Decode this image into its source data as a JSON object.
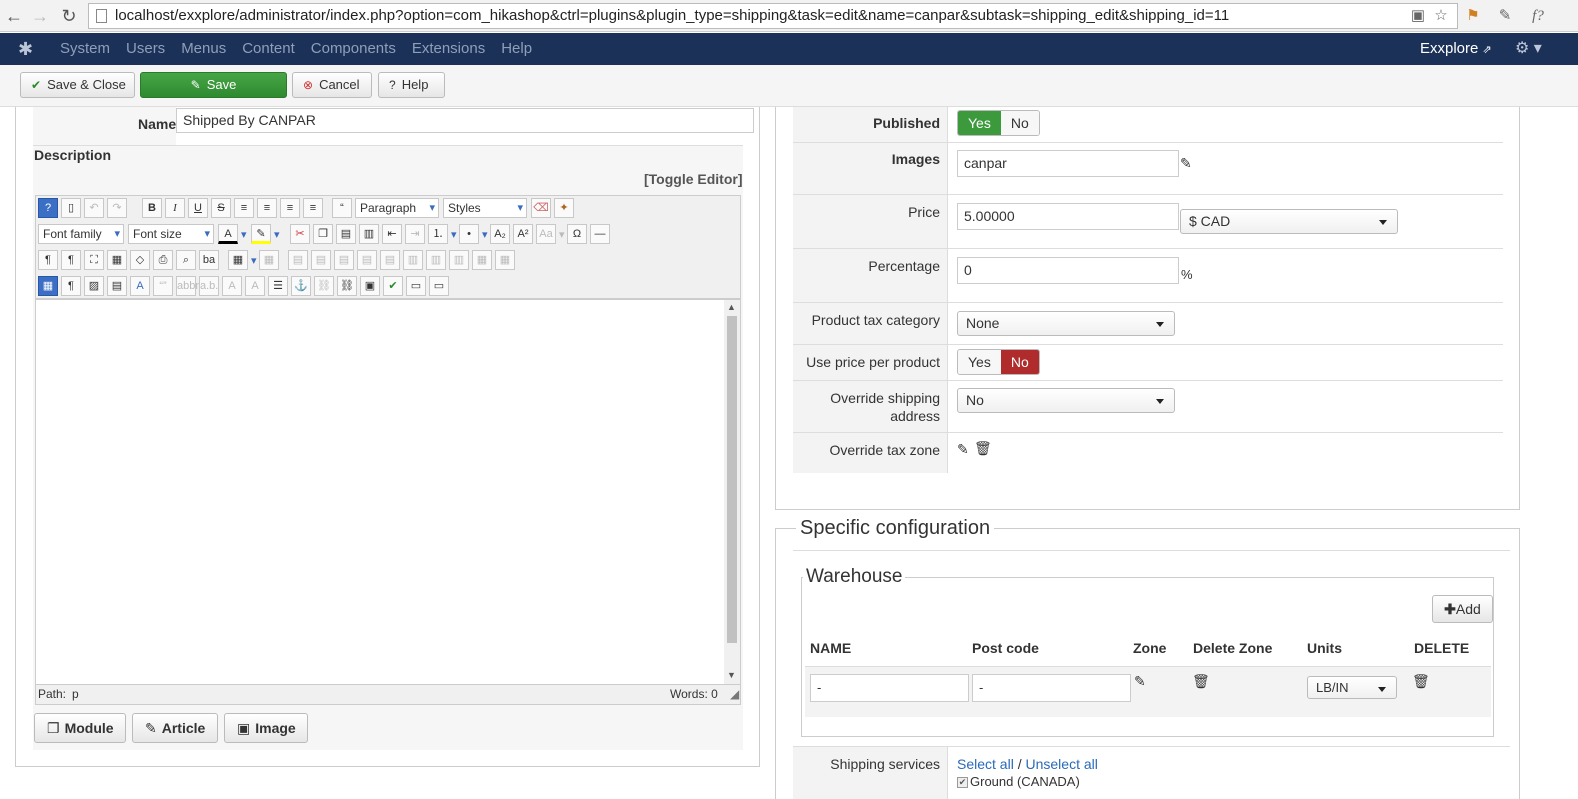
{
  "browser": {
    "url": "localhost/exxplore/administrator/index.php?option=com_hikashop&ctrl=plugins&plugin_type=shipping&task=edit&name=canpar&subtask=shipping_edit&shipping_id=11"
  },
  "navbar": {
    "menu": [
      "System",
      "Users",
      "Menus",
      "Content",
      "Components",
      "Extensions",
      "Help"
    ],
    "site_name": "Exxplore"
  },
  "toolbar": {
    "save_close": "Save & Close",
    "save": "Save",
    "cancel": "Cancel",
    "help": "Help"
  },
  "left": {
    "name_label": "Name",
    "name_value": "Shipped By CANPAR",
    "description_label": "Description",
    "toggle_editor": "[Toggle Editor]",
    "format_select": "Paragraph",
    "styles_select": "Styles",
    "font_family": "Font family",
    "font_size": "Font size",
    "path_label": "Path:",
    "path_value": "p",
    "words": "Words: 0",
    "buttons": {
      "module": "Module",
      "article": "Article",
      "image": "Image"
    }
  },
  "right": {
    "published_label": "Published",
    "published_yes": "Yes",
    "published_no": "No",
    "images_label": "Images",
    "images_value": "canpar",
    "price_label": "Price",
    "price_value": "5.00000",
    "currency": "$ CAD",
    "percentage_label": "Percentage",
    "percentage_value": "0",
    "percentage_unit": "%",
    "tax_category_label": "Product tax category",
    "tax_category_value": "None",
    "price_per_product_label": "Use price per product",
    "ppp_yes": "Yes",
    "ppp_no": "No",
    "override_address_label": "Override shipping address",
    "override_address_value": "No",
    "override_tax_label": "Override tax zone"
  },
  "specific": {
    "title": "Specific configuration",
    "warehouse_title": "Warehouse",
    "add_label": "Add",
    "columns": [
      "NAME",
      "Post code",
      "Zone",
      "Delete Zone",
      "Units",
      "DELETE"
    ],
    "row": {
      "name": "-",
      "post_code": "-",
      "units": "LB/IN"
    },
    "services_label": "Shipping services",
    "select_all": "Select all",
    "separator": "/",
    "unselect_all": "Unselect all",
    "service_item": "Ground (CANADA)"
  }
}
